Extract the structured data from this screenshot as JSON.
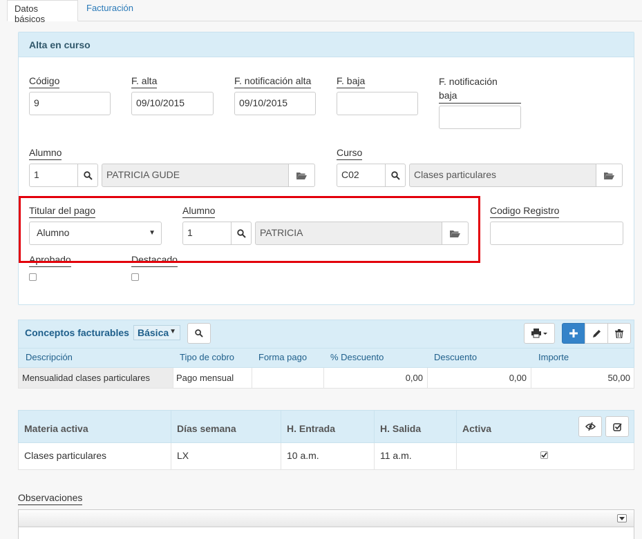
{
  "tabs": [
    {
      "label": "Datos básicos",
      "active": true
    },
    {
      "label": "Facturación",
      "active": false
    }
  ],
  "panel": {
    "title": "Alta en curso",
    "fields": {
      "codigo": {
        "label": "Código",
        "value": "9"
      },
      "f_alta": {
        "label": "F. alta",
        "value": "09/10/2015"
      },
      "f_notif_alta": {
        "label": "F. notificación alta",
        "value": "09/10/2015"
      },
      "f_baja": {
        "label": "F. baja",
        "value": ""
      },
      "f_notif_baja": {
        "label_line1": "F. notificación",
        "label_line2": "baja",
        "value": ""
      },
      "alumno": {
        "label": "Alumno",
        "code": "1",
        "name": "PATRICIA GUDE"
      },
      "curso": {
        "label": "Curso",
        "code": "C02",
        "name": "Clases particulares"
      },
      "titular_pago": {
        "label": "Titular del pago",
        "value": "Alumno"
      },
      "alumno_pago": {
        "label": "Alumno",
        "code": "1",
        "name": "PATRICIA"
      },
      "codigo_registro": {
        "label": "Codigo Registro",
        "value": ""
      },
      "aprobado": {
        "label": "Aprobado",
        "checked": false
      },
      "destacado": {
        "label": "Destacado",
        "checked": false
      }
    }
  },
  "conceptos": {
    "title": "Conceptos facturables",
    "view_select": "Básica",
    "columns": [
      "Descripción",
      "Tipo de cobro",
      "Forma pago",
      "% Descuento",
      "Descuento",
      "Importe"
    ],
    "rows": [
      [
        "Mensualidad clases particulares",
        "Pago mensual",
        "",
        "0,00",
        "0,00",
        "50,00"
      ]
    ]
  },
  "materias": {
    "columns": [
      "Materia activa",
      "Días semana",
      "H. Entrada",
      "H. Salida",
      "Activa"
    ],
    "rows": [
      {
        "materia": "Clases particulares",
        "dias": "LX",
        "entrada": "10 a.m.",
        "salida": "11 a.m.",
        "activa": true
      }
    ]
  },
  "observaciones": {
    "label": "Observaciones"
  },
  "colors": {
    "accent": "#2a7ab8",
    "header_bg": "#d9edf7",
    "highlight": "#e3000b"
  }
}
